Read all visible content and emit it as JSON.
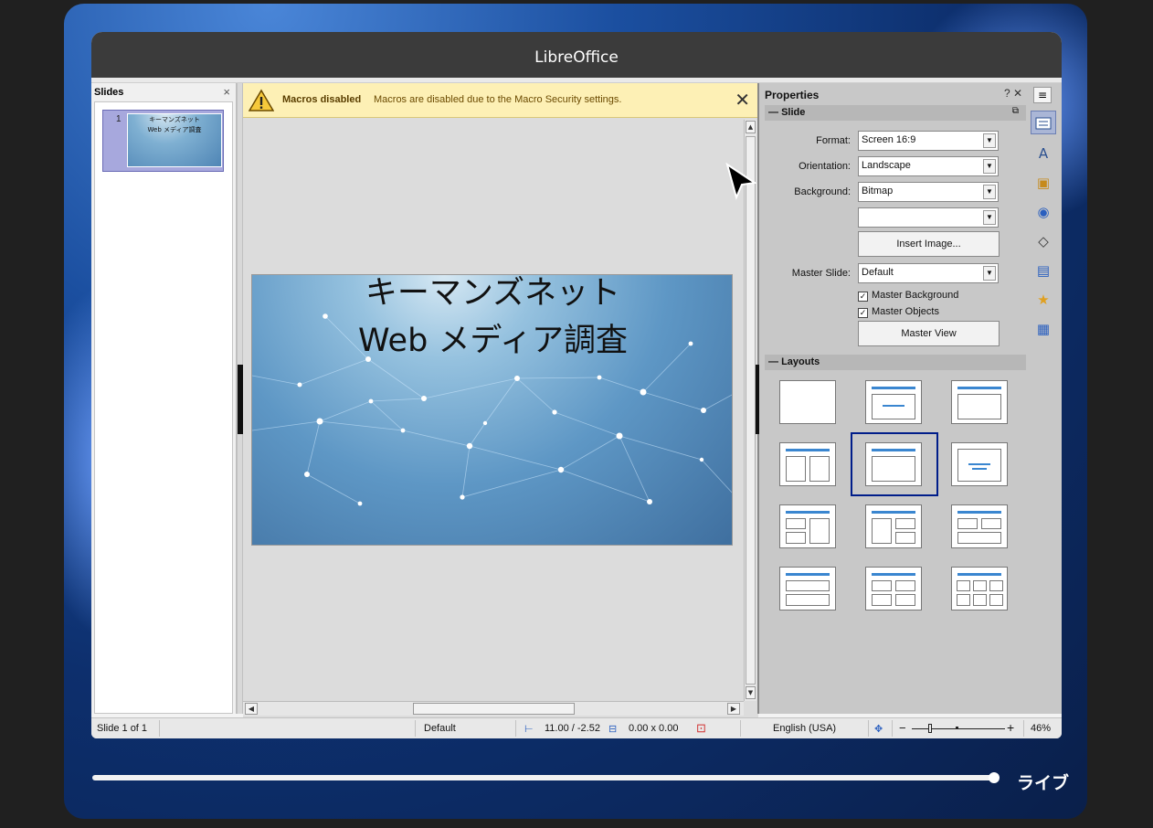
{
  "window": {
    "title": "LibreOffice"
  },
  "slides_pane": {
    "title": "Slides",
    "close": "×",
    "thumb_number": "1",
    "thumb_line1": "キーマンズネット",
    "thumb_line2": "Web メディア調査"
  },
  "infobar": {
    "title": "Macros disabled",
    "message": "Macros are disabled due to the Macro Security settings.",
    "close": "✕"
  },
  "slide": {
    "title_line1": "キーマンズネット",
    "title_line2": "Web メディア調査"
  },
  "properties": {
    "title": "Properties",
    "controls": "? ✕",
    "slide_section": "Slide",
    "format_label": "Format:",
    "format_value": "Screen 16:9",
    "orientation_label": "Orientation:",
    "orientation_value": "Landscape",
    "background_label": "Background:",
    "background_value": "Bitmap",
    "background_sub_value": "",
    "insert_image": "Insert Image...",
    "master_slide_label": "Master Slide:",
    "master_slide_value": "Default",
    "master_background": "Master Background",
    "master_objects": "Master Objects",
    "master_view": "Master View",
    "layouts_section": "Layouts"
  },
  "statusbar": {
    "slide": "Slide 1 of 1",
    "master": "Default",
    "position": "11.00 / -2.52",
    "size": "0.00 x 0.00",
    "language": "English (USA)",
    "zoom_minus": "−",
    "zoom_plus": "+",
    "zoom": "46%"
  },
  "player": {
    "live": "ライブ"
  },
  "colors": {
    "accent": "#3a86d0",
    "selection": "#001d8a",
    "infobar": "#fdf0b5"
  }
}
